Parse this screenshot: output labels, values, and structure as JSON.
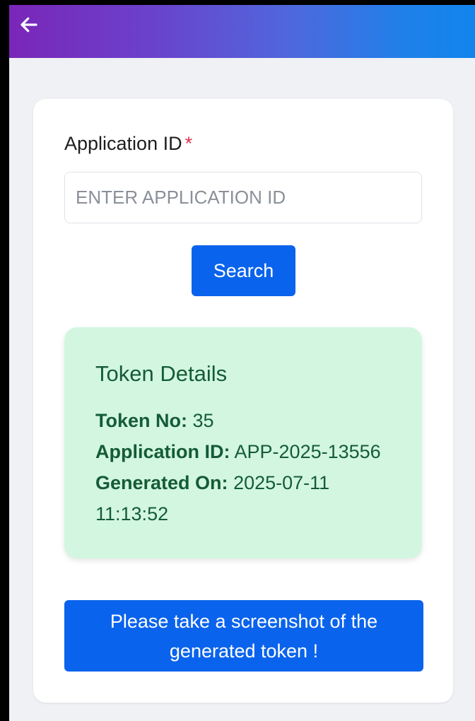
{
  "header": {
    "back_icon": "arrow-left-icon",
    "gradient_start": "#7a26b8",
    "gradient_end": "#1185ec"
  },
  "form": {
    "label": "Application ID",
    "required_mark": "*",
    "input_value": "",
    "input_placeholder": "ENTER APPLICATION ID",
    "search_label": "Search"
  },
  "token": {
    "title": "Token Details",
    "token_no_label": "Token No:",
    "token_no_value": "35",
    "application_id_label": "Application ID:",
    "application_id_value": "APP-2025-13556",
    "generated_on_label": "Generated On:",
    "generated_on_date": "2025-07-11",
    "generated_on_time": "11:13:52"
  },
  "notice": {
    "text": "Please take a screenshot of the generated token !"
  },
  "colors": {
    "primary_button": "#0a63ec",
    "token_box_bg": "#d3f6e1",
    "token_text": "#145c36",
    "required": "#e0324c",
    "page_bg": "#eff1f4"
  }
}
